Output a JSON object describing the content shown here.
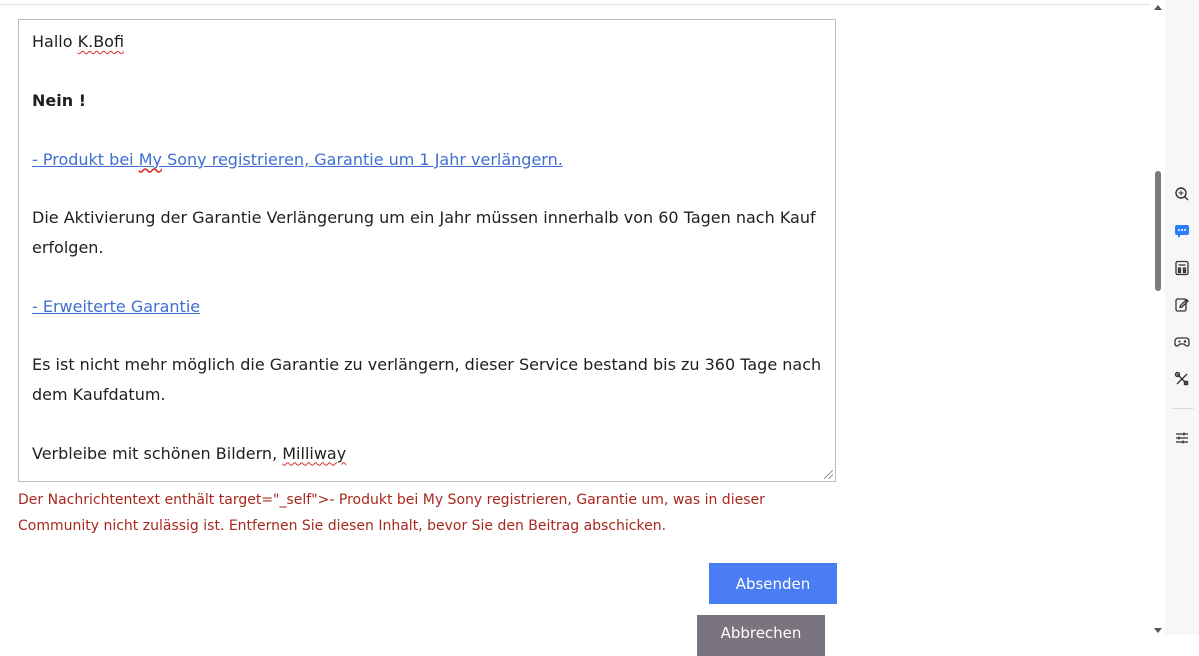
{
  "editor": {
    "greeting": "Hallo",
    "username": "K.Bofi",
    "answer": "Nein !",
    "link1_prefix": "- Produkt bei ",
    "link1_brand": "My",
    "link1_rest": " Sony registrieren, Garantie um 1 Jahr verlängern.",
    "para1": "Die Aktivierung der Garantie Verlängerung um ein Jahr müssen innerhalb von 60 Tagen nach Kauf erfolgen.",
    "link2": "- Erweiterte Garantie",
    "para2": "Es ist nicht mehr möglich die Garantie zu verlängern, dieser Service bestand bis zu 360 Tage nach dem Kaufdatum.",
    "closing": "Verbleibe mit schönen Bildern,",
    "signature": "Milliway"
  },
  "error_message": "Der Nachrichtentext enthält target=\"_self\">- Produkt bei  My Sony registrieren, Garantie um, was in dieser Community nicht zulässig ist. Entfernen Sie diesen Inhalt, bevor Sie den Beitrag abschicken.",
  "buttons": {
    "send": "Absenden",
    "cancel": "Abbrechen"
  },
  "sidebar_icons": [
    "search-sparkle-icon",
    "chat-icon",
    "calculator-icon",
    "edit-note-icon",
    "gamepad-icon",
    "tools-icon",
    "settings-sliders-icon"
  ],
  "colors": {
    "link": "#3e6fd1",
    "error": "#a8281e",
    "send_button": "#4a7cf3",
    "cancel_button": "#79747e",
    "spellcheck": "#d93025"
  }
}
